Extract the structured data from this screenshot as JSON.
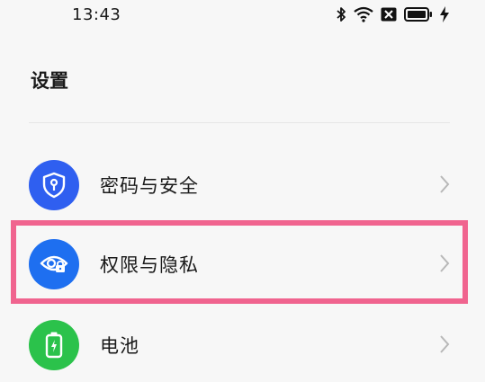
{
  "status_bar": {
    "time": "13:43",
    "icons": [
      "bluetooth-icon",
      "wifi-icon",
      "sim-off-icon",
      "battery-icon",
      "charging-icon"
    ]
  },
  "page": {
    "title": "设置"
  },
  "rows": [
    {
      "label": "密码与安全",
      "icon": "shield-lock-icon",
      "icon_bg": "#2f5ff0"
    },
    {
      "label": "权限与隐私",
      "icon": "eye-lock-icon",
      "icon_bg": "#1e6ff0"
    },
    {
      "label": "电池",
      "icon": "battery-charge-icon",
      "icon_bg": "#2bc24b"
    }
  ],
  "colors": {
    "highlight": "#f0648f",
    "background": "#f7f7f7",
    "chevron": "#b8b8b8"
  }
}
